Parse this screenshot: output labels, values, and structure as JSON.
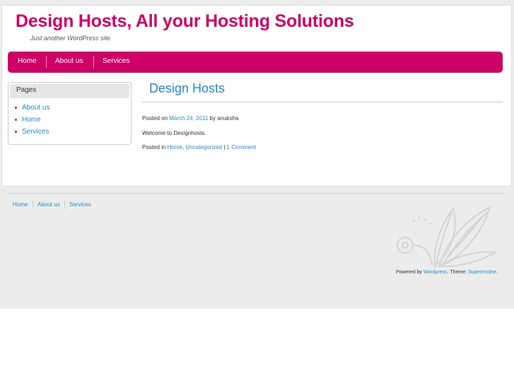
{
  "site": {
    "title": "Design Hosts, All your Hosting Solutions",
    "tagline": "Just another WordPress site"
  },
  "nav": {
    "items": [
      "Home",
      "About us",
      "Services"
    ]
  },
  "sidebar": {
    "title": "Pages",
    "items": [
      "About us",
      "Home",
      "Services"
    ]
  },
  "post": {
    "title": "Design Hosts",
    "posted_on": "Posted on",
    "date": "March 24, 2011",
    "by": "by",
    "author": "anuksha",
    "body": "Welcome to Designhosts.",
    "posted_in": "Posted in",
    "cat1": "Home",
    "comma": ",",
    "cat2": "Uncategorized",
    "pipe": "|",
    "comments": "1 Comment"
  },
  "footer": {
    "nav": [
      "Home",
      "About us",
      "Services"
    ],
    "powered_by": "Powered by",
    "wordpress": "Wordpress",
    "theme_label": ". Theme:",
    "theme": "Supermodne",
    "end": "."
  },
  "colors": {
    "accent": "#cc0066",
    "link": "#2a8ac6",
    "background": "#ececec"
  },
  "icons": {
    "footer_decoration": "leaf-swirl-icon",
    "list_bullet": "bullet-icon"
  }
}
